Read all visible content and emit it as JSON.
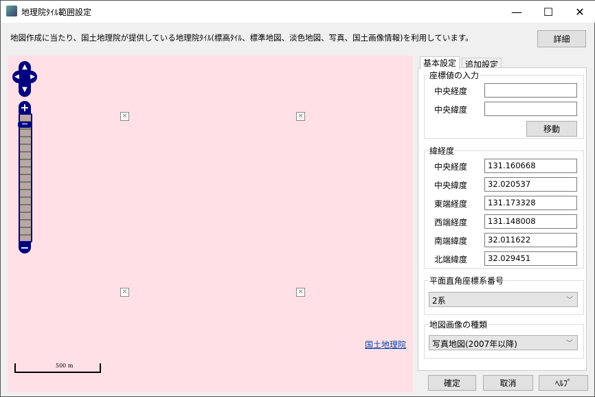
{
  "window": {
    "title": "地理院ﾀｲﾙ範囲設定",
    "minimize": "—",
    "maximize": "☐",
    "close": "✕"
  },
  "info": {
    "text": "地図作成に当たり、国土地理院が提供している地理院ﾀｲﾙ(標高ﾀｲﾙ、標準地図、淡色地図、写真、国土画像情報)を利用しています。",
    "details_button": "詳細"
  },
  "map": {
    "attribution_link": "国土地理院",
    "scale_label": "500 m",
    "zoom_in": "+",
    "zoom_out": "−",
    "pan_up": "▲",
    "pan_down": "▼",
    "pan_left": "◀",
    "pan_right": "▶",
    "zoom_level_fraction": 0.05,
    "broken_tile": "✕"
  },
  "tabs": [
    {
      "label": "基本設定",
      "active": true
    },
    {
      "label": "追加設定",
      "active": false
    }
  ],
  "coord_input": {
    "title": "座標値の入力",
    "center_lon_label": "中央経度",
    "center_lon_value": "",
    "center_lat_label": "中央緯度",
    "center_lat_value": "",
    "move_button": "移動"
  },
  "latlon": {
    "title": "緯経度",
    "rows": [
      {
        "label": "中央経度",
        "value": "131.160668"
      },
      {
        "label": "中央緯度",
        "value": "32.020537"
      },
      {
        "label": "東端経度",
        "value": "131.173328"
      },
      {
        "label": "西端経度",
        "value": "131.148008"
      },
      {
        "label": "南端緯度",
        "value": "32.011622"
      },
      {
        "label": "北端緯度",
        "value": "32.029451"
      }
    ]
  },
  "plane": {
    "title": "平面直角座標系番号",
    "selected": "2系"
  },
  "imagetype": {
    "title": "地図画像の種類",
    "selected": "写真地図(2007年以降)"
  },
  "buttons": {
    "ok": "確定",
    "cancel": "取消",
    "help": "ﾍﾙﾌﾟ"
  }
}
